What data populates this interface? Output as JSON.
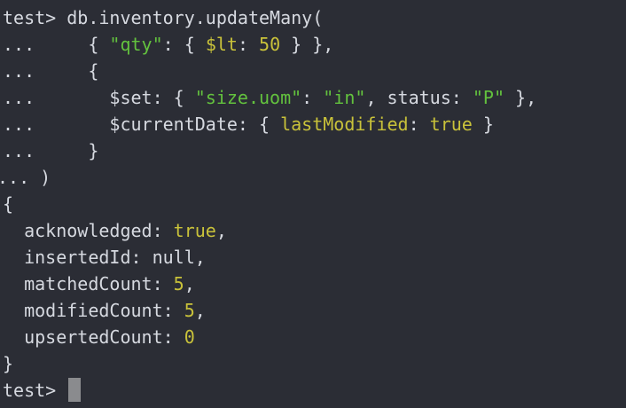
{
  "terminal": {
    "lines": [
      [
        {
          "t": "test> db.inventory.updateMany(",
          "c": "plain"
        }
      ],
      [
        {
          "t": "...     { ",
          "c": "plain"
        },
        {
          "t": "\"qty\"",
          "c": "str"
        },
        {
          "t": ": { ",
          "c": "plain"
        },
        {
          "t": "$lt",
          "c": "kw"
        },
        {
          "t": ": ",
          "c": "plain"
        },
        {
          "t": "50",
          "c": "num"
        },
        {
          "t": " } },",
          "c": "plain"
        }
      ],
      [
        {
          "t": "...     {",
          "c": "plain"
        }
      ],
      [
        {
          "t": "...       $set: { ",
          "c": "plain"
        },
        {
          "t": "\"size.uom\"",
          "c": "str"
        },
        {
          "t": ": ",
          "c": "plain"
        },
        {
          "t": "\"in\"",
          "c": "str"
        },
        {
          "t": ", status: ",
          "c": "plain"
        },
        {
          "t": "\"P\"",
          "c": "str"
        },
        {
          "t": " },",
          "c": "plain"
        }
      ],
      [
        {
          "t": "...       $currentDate: { ",
          "c": "plain"
        },
        {
          "t": "lastModified",
          "c": "kw"
        },
        {
          "t": ": ",
          "c": "plain"
        },
        {
          "t": "true",
          "c": "kw"
        },
        {
          "t": " }",
          "c": "plain"
        }
      ],
      [
        {
          "t": "...     }",
          "c": "plain"
        }
      ],
      [
        {
          "t": "... )",
          "c": "plain"
        }
      ],
      [
        {
          "t": "{",
          "c": "plain"
        }
      ],
      [
        {
          "t": "  acknowledged: ",
          "c": "plain"
        },
        {
          "t": "true",
          "c": "kw"
        },
        {
          "t": ",",
          "c": "plain"
        }
      ],
      [
        {
          "t": "  insertedId: null,",
          "c": "plain"
        }
      ],
      [
        {
          "t": "  matchedCount: ",
          "c": "plain"
        },
        {
          "t": "5",
          "c": "num"
        },
        {
          "t": ",",
          "c": "plain"
        }
      ],
      [
        {
          "t": "  modifiedCount: ",
          "c": "plain"
        },
        {
          "t": "5",
          "c": "num"
        },
        {
          "t": ",",
          "c": "plain"
        }
      ],
      [
        {
          "t": "  upsertedCount: ",
          "c": "plain"
        },
        {
          "t": "0",
          "c": "num"
        }
      ],
      [
        {
          "t": "}",
          "c": "plain"
        }
      ]
    ],
    "prompt": "test> ",
    "colors": {
      "background": "#2b2d35",
      "text": "#d6d9e0",
      "string": "#63c23e",
      "keyword": "#c9c23a",
      "cursor": "#8a8b8e"
    }
  }
}
